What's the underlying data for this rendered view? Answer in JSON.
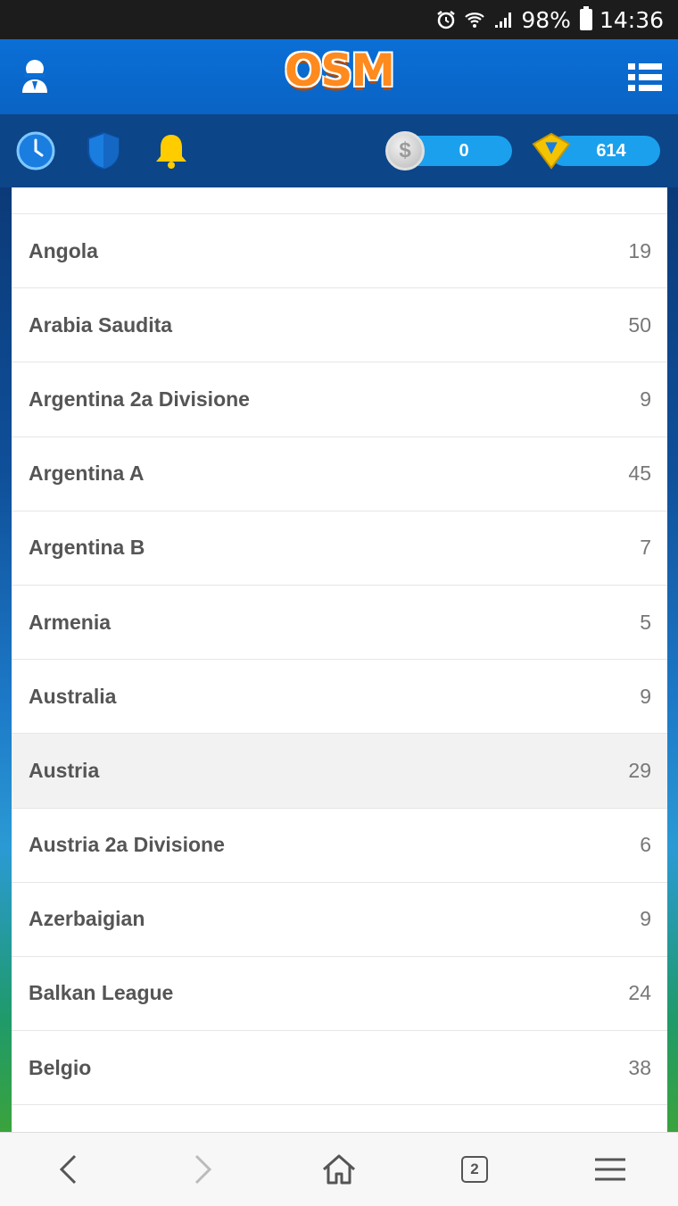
{
  "status_bar": {
    "battery": "98%",
    "time": "14:36",
    "icons": [
      "alarm-icon",
      "wifi-icon",
      "signal-icon",
      "battery-icon"
    ]
  },
  "header": {
    "logo": "OSM",
    "icons": [
      "manager-avatar-icon",
      "menu-list-icon"
    ]
  },
  "toolbar": {
    "icons": [
      "clock-icon",
      "shield-icon",
      "bell-icon"
    ],
    "coins_value": "0",
    "boss_coins_value": "614"
  },
  "leagues": [
    {
      "name": "Angola",
      "count": "19"
    },
    {
      "name": "Arabia Saudita",
      "count": "50"
    },
    {
      "name": "Argentina 2a Divisione",
      "count": "9"
    },
    {
      "name": "Argentina A",
      "count": "45"
    },
    {
      "name": "Argentina B",
      "count": "7"
    },
    {
      "name": "Armenia",
      "count": "5"
    },
    {
      "name": "Australia",
      "count": "9"
    },
    {
      "name": "Austria",
      "count": "29"
    },
    {
      "name": "Austria 2a Divisione",
      "count": "6"
    },
    {
      "name": "Azerbaigian",
      "count": "9"
    },
    {
      "name": "Balkan League",
      "count": "24"
    },
    {
      "name": "Belgio",
      "count": "38"
    }
  ],
  "bottom_nav": {
    "tab_count": "2",
    "icons": [
      "back-icon",
      "forward-icon",
      "home-icon",
      "tabs-icon",
      "hamburger-icon"
    ]
  },
  "colors": {
    "header_blue": "#0a6fd6",
    "toolbar_blue": "#0c4588",
    "counter_blue": "#1ba0ee",
    "logo_orange": "#ff8a1e",
    "selected_row": "#f2f2f2"
  }
}
